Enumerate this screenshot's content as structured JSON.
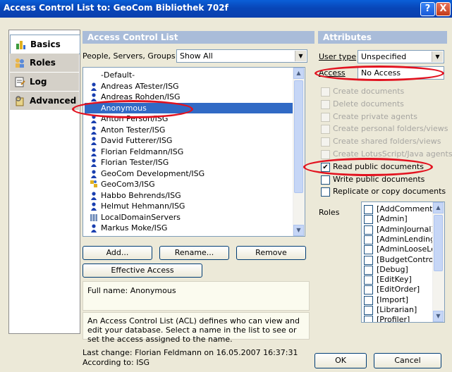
{
  "window": {
    "title": "Access Control List to: GeoCom Bibliothek 702f",
    "help": "?",
    "close": "X"
  },
  "nav": [
    {
      "label": "Basics",
      "icon": "basics-icon"
    },
    {
      "label": "Roles",
      "icon": "roles-icon"
    },
    {
      "label": "Log",
      "icon": "log-icon"
    },
    {
      "label": "Advanced",
      "icon": "advanced-icon"
    }
  ],
  "acl": {
    "header": "Access Control List",
    "filter_label": "People, Servers, Groups",
    "filter_value": "Show All",
    "entries": [
      "-Default-",
      "Andreas ATester/ISG",
      "Andreas Rohden/ISG",
      "Anonymous",
      "Anton Person/ISG",
      "Anton Tester/ISG",
      "David Futterer/ISG",
      "Florian Feldmann/ISG",
      "Florian Tester/ISG",
      "GeoCom Development/ISG",
      "GeoCom3/ISG",
      "Habbo Behrends/ISG",
      "Helmut Hehmann/ISG",
      "LocalDomainServers",
      "Markus Moke/ISG"
    ],
    "selected": "Anonymous",
    "buttons": {
      "add": "Add...",
      "rename": "Rename...",
      "remove": "Remove",
      "effective": "Effective Access"
    },
    "fullname": "Full name: Anonymous",
    "description": "An Access Control List (ACL) defines who can view and edit your database. Select a name in the list to see or set the access assigned to the name."
  },
  "attributes": {
    "header": "Attributes",
    "user_type_label": "User type",
    "user_type_value": "Unspecified",
    "access_label": "Access",
    "access_value": "No Access",
    "options": [
      {
        "label": "Create documents",
        "checked": false,
        "enabled": false
      },
      {
        "label": "Delete documents",
        "checked": false,
        "enabled": false
      },
      {
        "label": "Create private agents",
        "checked": false,
        "enabled": false
      },
      {
        "label": "Create personal folders/views",
        "checked": false,
        "enabled": false
      },
      {
        "label": "Create shared folders/views",
        "checked": false,
        "enabled": false
      },
      {
        "label": "Create LotusScript/Java agents",
        "checked": false,
        "enabled": false
      },
      {
        "label": "Read public documents",
        "checked": true,
        "enabled": true
      },
      {
        "label": "Write public documents",
        "checked": false,
        "enabled": true
      },
      {
        "label": "Replicate or copy documents",
        "checked": false,
        "enabled": true
      }
    ],
    "roles_label": "Roles",
    "roles": [
      "[AddComment]",
      "[Admin]",
      "[AdminJournal]",
      "[AdminLending]",
      "[AdminLooseLea",
      "[BudgetControl]",
      "[Debug]",
      "[EditKey]",
      "[EditOrder]",
      "[Import]",
      "[Librarian]",
      "[Profiler]"
    ]
  },
  "footer": {
    "last_change": "Last change: Florian Feldmann on 16.05.2007 16:37:31",
    "according": "According to: ISG",
    "ok": "OK",
    "cancel": "Cancel"
  },
  "colors": {
    "highlight": "#e2121f",
    "selection": "#316ac5"
  }
}
